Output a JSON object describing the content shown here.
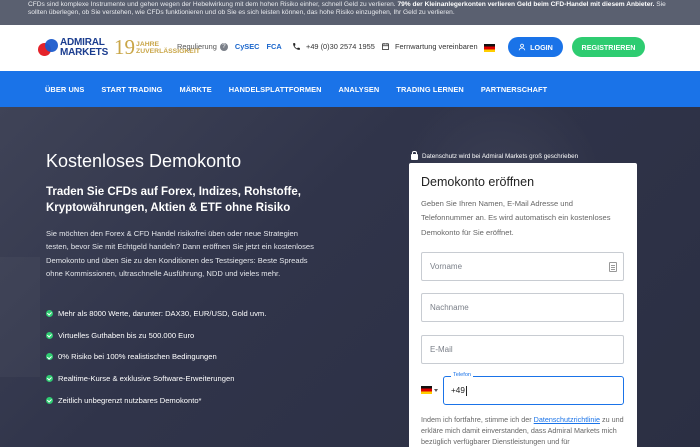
{
  "risk_banner": {
    "line1": "CFDs sind komplexe Instrumente und gehen wegen der Hebelwirkung mit dem hohen Risiko einher, schnell Geld zu verlieren.",
    "bold": "79% der Kleinanlegerkonten verlieren Geld beim CFD-Handel mit diesem Anbieter.",
    "line2": "Sie sollten überlegen, ob Sie verstehen, wie CFDs funktionieren und ob Sie es sich leisten können, das hohe Risiko einzugehen, Ihr Geld zu verlieren."
  },
  "header": {
    "logo_line1": "ADMIRAL",
    "logo_line2": "MARKETS",
    "years_number": "19",
    "years_line1": "JAHRE",
    "years_line2": "ZUVERLÄSSIGKEIT",
    "regulation_label": "Regulierung",
    "regulator1": "CySEC",
    "regulator2": "FCA",
    "phone": "+49 (0)30 2574 1955",
    "remote": "Fernwartung vereinbaren",
    "login": "LOGIN",
    "register": "REGISTRIEREN"
  },
  "nav": {
    "items": [
      "ÜBER UNS",
      "START TRADING",
      "MÄRKTE",
      "HANDELSPLATTFORMEN",
      "ANALYSEN",
      "TRADING LERNEN",
      "PARTNERSCHAFT"
    ]
  },
  "hero": {
    "title": "Kostenloses Demokonto",
    "subtitle": "Traden Sie CFDs auf Forex, Indizes, Rohstoffe, Kryptowährungen, Aktien & ETF ohne Risiko",
    "description": "Sie möchten den Forex & CFD Handel risikofrei üben oder neue Strategien testen, bevor Sie mit Echtgeld handeln? Dann eröffnen Sie jetzt ein kostenloses Demokonto und üben Sie zu den Konditionen des Testsiegers: Beste Spreads ohne Kommissionen, ultraschnelle Ausführung, NDD und vieles mehr.",
    "bullets": [
      "Mehr als 8000 Werte, darunter: DAX30, EUR/USD, Gold uvm.",
      "Virtuelles Guthaben bis zu 500.000 Euro",
      "0% Risiko bei 100% realistischen Bedingungen",
      "Realtime-Kurse & exklusive Software-Erweiterungen",
      "Zeitlich unbegrenzt nutzbares Demokonto*"
    ],
    "privacy_note": "Datenschutz wird bei Admiral Markets groß geschrieben"
  },
  "form": {
    "title": "Demokonto eröffnen",
    "description": "Geben Sie Ihren Namen, E-Mail Adresse und Telefonnummer an. Es wird automatisch ein kostenloses Demokonto für Sie eröffnet.",
    "first_name_placeholder": "Vorname",
    "last_name_placeholder": "Nachname",
    "email_placeholder": "E-Mail",
    "phone_label": "Telefon",
    "phone_value": "+49",
    "consent_pre": "Indem ich fortfahre, stimme ich der",
    "consent_link": "Datenschutzrichtlinie",
    "consent_post": "zu und erkläre mich damit einverstanden, dass Admiral Markets mich bezüglich verfügbarer Dienstleistungen und für"
  },
  "colors": {
    "nav_blue": "#1a73e8",
    "register_green": "#2ecc71",
    "hero_bg": "#30344a",
    "banner_bg": "#5a6070"
  }
}
